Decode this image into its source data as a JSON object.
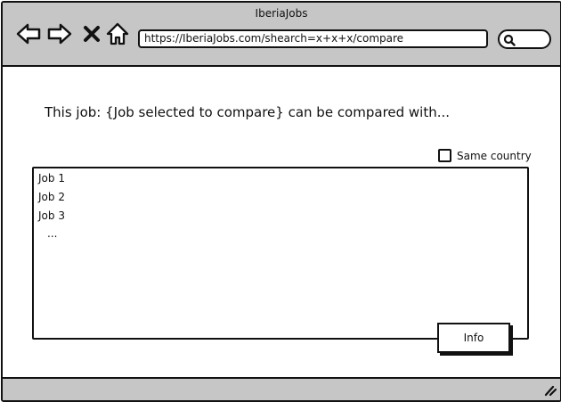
{
  "window": {
    "title": "IberiaJobs"
  },
  "nav": {
    "back_icon": "arrow-left-icon",
    "forward_icon": "arrow-right-icon",
    "stop_icon": "close-icon",
    "home_icon": "home-icon"
  },
  "address_bar": {
    "url": "https://IberiaJobs.com/shearch=x+x+x/compare"
  },
  "search": {
    "icon": "search-icon"
  },
  "main": {
    "heading": "This job: {Job selected to compare} can be compared with...",
    "same_country": {
      "label": "Same country",
      "checked": false
    },
    "jobs": [
      "Job 1",
      "Job 2",
      "Job 3",
      "..."
    ],
    "info_button": "Info"
  },
  "colors": {
    "chrome": "#c6c6c6",
    "border": "#111111",
    "background": "#ffffff"
  }
}
